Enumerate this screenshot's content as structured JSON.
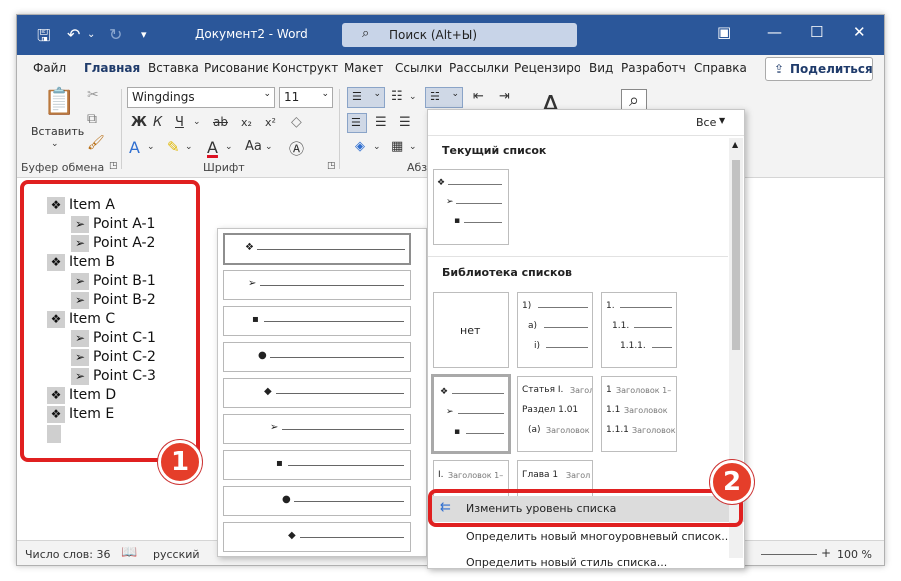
{
  "titlebar": {
    "doc_title": "Документ2 - Word",
    "search_placeholder": "Поиск (Alt+Ы)"
  },
  "tabs": [
    "Файл",
    "Главная",
    "Вставка",
    "Рисование",
    "Конструкт",
    "Макет",
    "Ссылки",
    "Рассылки",
    "Рецензиро",
    "Вид",
    "Разработч",
    "Справка"
  ],
  "share_label": "Поделиться",
  "ribbon": {
    "paste_label": "Вставить",
    "font_name": "Wingdings",
    "font_size": "11",
    "clipboard_group": "Буфер обмена",
    "font_group": "Шрифт",
    "paragraph_group_partial": "Абз",
    "bold": "Ж",
    "italic": "К",
    "underline": "Ч",
    "strike": "ab",
    "sub": "x₂",
    "sup": "x²",
    "font_size_btn": "Aa"
  },
  "document": {
    "items": [
      {
        "level": 0,
        "bullet": "❖",
        "text": "Item A"
      },
      {
        "level": 1,
        "bullet": "➢",
        "text": "Point A-1"
      },
      {
        "level": 1,
        "bullet": "➢",
        "text": "Point A-2"
      },
      {
        "level": 0,
        "bullet": "❖",
        "text": "Item B"
      },
      {
        "level": 1,
        "bullet": "➢",
        "text": "Point B-1"
      },
      {
        "level": 1,
        "bullet": "➢",
        "text": "Point B-2"
      },
      {
        "level": 0,
        "bullet": "❖",
        "text": "Item C"
      },
      {
        "level": 1,
        "bullet": "➢",
        "text": "Point C-1"
      },
      {
        "level": 1,
        "bullet": "➢",
        "text": "Point C-2"
      },
      {
        "level": 1,
        "bullet": "➢",
        "text": "Point C-3"
      },
      {
        "level": 0,
        "bullet": "❖",
        "text": "Item D"
      },
      {
        "level": 0,
        "bullet": "❖",
        "text": "Item E"
      }
    ]
  },
  "status": {
    "word_count": "Число слов: 36",
    "language": "русский",
    "zoom": "100 %"
  },
  "level_list": {
    "bullets": [
      "❖",
      "➢",
      "▪",
      "●",
      "◆",
      "➢",
      "▪",
      "●",
      "◆"
    ]
  },
  "list_panel": {
    "filter": "Все",
    "current_header": "Текущий список",
    "library_header": "Библиотека списков",
    "none_label": "нет",
    "numbered": {
      "r1": "1)",
      "r2": "a)",
      "r3": "i)"
    },
    "outline": {
      "r1": "1.",
      "r2": "1.1.",
      "r3": "1.1.1."
    },
    "bullets": {
      "r1": "❖",
      "r2": "➢",
      "r3": "▪"
    },
    "article": {
      "r1": "Статья I.",
      "r1b": "Загол",
      "r2": "Раздел 1.01",
      "r3": "(a)",
      "r3b": "Заголовок"
    },
    "headings": {
      "r1": "1",
      "r1b": "Заголовок 1–",
      "r2": "1.1",
      "r2b": "Заголовок",
      "r3": "1.1.1",
      "r3b": "Заголовок"
    },
    "partial1": {
      "r1": "I.",
      "r1b": "Заголовок 1–"
    },
    "partial2": {
      "r1": "Глава 1",
      "r1b": "Загол"
    },
    "menu_change_level": "Изменить уровень списка",
    "menu_define_list": "Определить новый многоуровневый список...",
    "menu_define_style": "Определить новый стиль списка..."
  },
  "badges": {
    "one": "1",
    "two": "2"
  }
}
